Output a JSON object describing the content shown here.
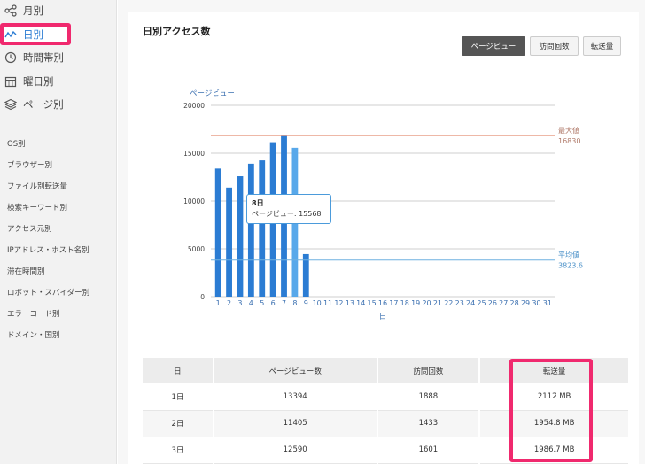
{
  "sidebar": {
    "items": [
      {
        "label": "月別",
        "icon": "share-nodes-icon"
      },
      {
        "label": "日別",
        "icon": "line-chart-icon",
        "active": true
      },
      {
        "label": "時間帯別",
        "icon": "clock-icon"
      },
      {
        "label": "曜日別",
        "icon": "calendar-icon"
      },
      {
        "label": "ページ別",
        "icon": "layers-icon"
      }
    ],
    "sub_items": [
      "OS別",
      "ブラウザー別",
      "ファイル別転送量",
      "検索キーワード別",
      "アクセス元別",
      "IPアドレス・ホスト名別",
      "滞在時間別",
      "ロボット・スパイダー別",
      "エラーコード別",
      "ドメイン・国別"
    ]
  },
  "main": {
    "title": "日別アクセス数",
    "tabs": [
      "ページビュー",
      "訪問回数",
      "転送量"
    ],
    "active_tab": 0
  },
  "chart_data": {
    "type": "bar",
    "ylabel": "ページビュー",
    "xlabel": "日",
    "categories": [
      "1",
      "2",
      "3",
      "4",
      "5",
      "6",
      "7",
      "8",
      "9",
      "10",
      "11",
      "12",
      "13",
      "14",
      "15",
      "16",
      "17",
      "18",
      "19",
      "20",
      "21",
      "22",
      "23",
      "24",
      "25",
      "26",
      "27",
      "28",
      "29",
      "30",
      "31"
    ],
    "values": [
      13394,
      11405,
      12590,
      13900,
      14250,
      16150,
      16830,
      15568,
      4450,
      null,
      null,
      null,
      null,
      null,
      null,
      null,
      null,
      null,
      null,
      null,
      null,
      null,
      null,
      null,
      null,
      null,
      null,
      null,
      null,
      null,
      null
    ],
    "ylim": [
      0,
      20000
    ],
    "yticks": [
      "0",
      "5000",
      "10000",
      "15000",
      "20000"
    ],
    "max_line": {
      "label": "最大値",
      "value": "16830",
      "color": "#e8a08a"
    },
    "avg_line": {
      "label": "平均値",
      "value": "3823.6",
      "color": "#6fb0e0"
    },
    "bar_color": "#2b7cd3",
    "highlight_color": "#58a8ea",
    "grid": true
  },
  "tooltip": {
    "title": "8日",
    "text": "ページビュー: 15568"
  },
  "table": {
    "headers": [
      "日",
      "ページビュー数",
      "訪問回数",
      "転送量"
    ],
    "rows": [
      [
        "1日",
        "13394",
        "1888",
        "2112 MB"
      ],
      [
        "2日",
        "11405",
        "1433",
        "1954.8 MB"
      ],
      [
        "3日",
        "12590",
        "1601",
        "1986.7 MB"
      ]
    ]
  }
}
